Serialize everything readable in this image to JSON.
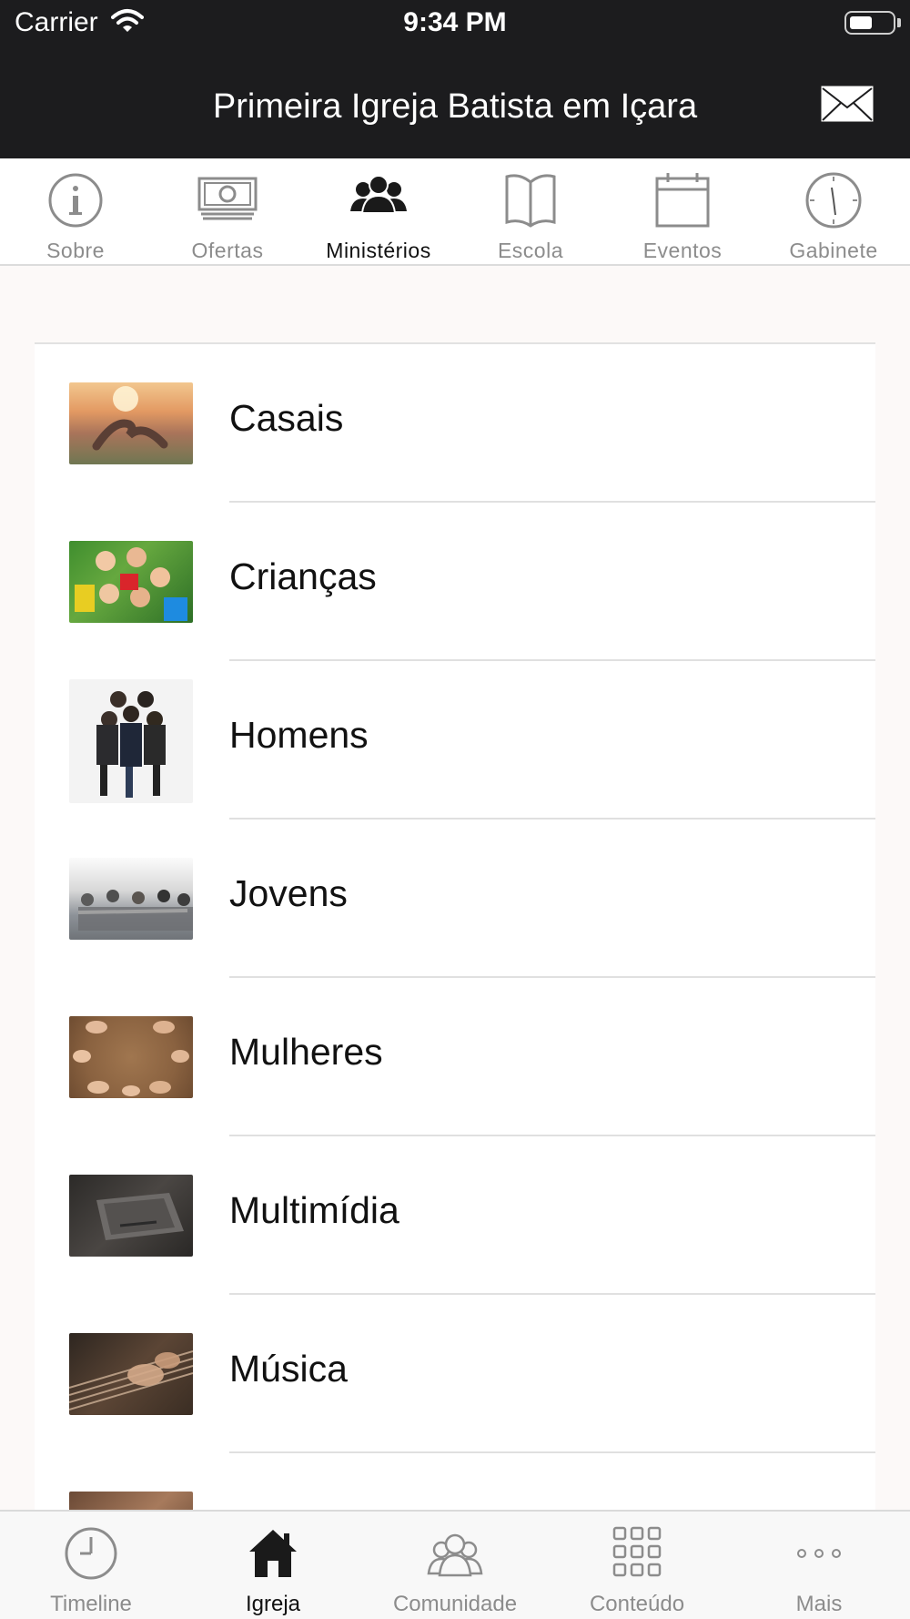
{
  "status_bar": {
    "carrier": "Carrier",
    "time": "9:34 PM"
  },
  "header": {
    "title": "Primeira Igreja Batista em Içara",
    "mail_icon": "envelope-icon"
  },
  "tabs": [
    {
      "label": "Sobre",
      "icon": "info-icon",
      "active": false
    },
    {
      "label": "Ofertas",
      "icon": "money-icon",
      "active": false
    },
    {
      "label": "Ministérios",
      "icon": "people-icon",
      "active": true
    },
    {
      "label": "Escola",
      "icon": "book-icon",
      "active": false
    },
    {
      "label": "Eventos",
      "icon": "calendar-icon",
      "active": false
    },
    {
      "label": "Gabinete",
      "icon": "clock-icon",
      "active": false
    }
  ],
  "ministries": [
    {
      "label": "Casais"
    },
    {
      "label": "Crianças"
    },
    {
      "label": "Homens"
    },
    {
      "label": "Jovens"
    },
    {
      "label": "Mulheres"
    },
    {
      "label": "Multimídia"
    },
    {
      "label": "Música"
    }
  ],
  "bottom_nav": [
    {
      "label": "Timeline",
      "icon": "clock-icon",
      "active": false
    },
    {
      "label": "Igreja",
      "icon": "home-icon",
      "active": true
    },
    {
      "label": "Comunidade",
      "icon": "community-icon",
      "active": false
    },
    {
      "label": "Conteúdo",
      "icon": "grid-icon",
      "active": false
    },
    {
      "label": "Mais",
      "icon": "more-icon",
      "active": false
    }
  ],
  "colors": {
    "header_bg": "#1c1c1e",
    "active_text": "#111111",
    "inactive_text": "#8c8c8c",
    "page_bg": "#fcf9f8"
  }
}
